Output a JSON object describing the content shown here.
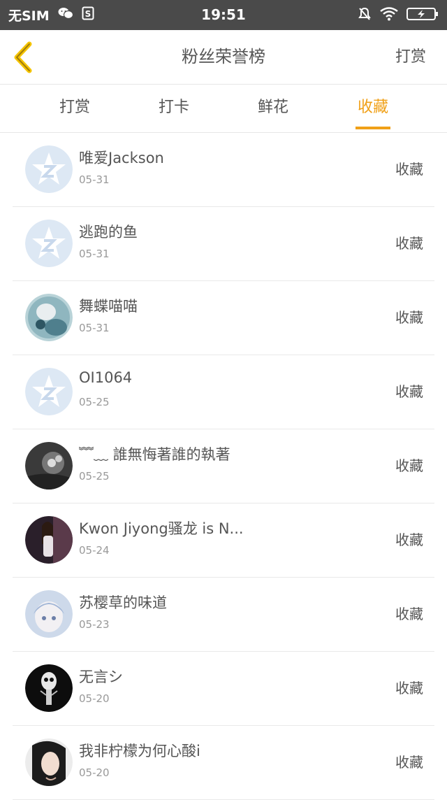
{
  "status_bar": {
    "carrier": "无SIM",
    "time": "19:51",
    "icons": [
      "wechat-icon",
      "sim-icon",
      "mute-icon",
      "wifi-icon",
      "battery-charging-icon"
    ]
  },
  "nav": {
    "title": "粉丝荣誉榜",
    "right_label": "打赏",
    "back_icon": "chevron-left-icon"
  },
  "tabs": [
    {
      "label": "打赏",
      "active": false
    },
    {
      "label": "打卡",
      "active": false
    },
    {
      "label": "鲜花",
      "active": false
    },
    {
      "label": "收藏",
      "active": true
    }
  ],
  "accent_color": "#f0a017",
  "fans": [
    {
      "name": "唯爱Jackson",
      "date": "05-31",
      "action": "收藏",
      "avatar": "default-star-avatar"
    },
    {
      "name": "逃跑的鱼",
      "date": "05-31",
      "action": "收藏",
      "avatar": "default-star-avatar"
    },
    {
      "name": "舞蝶喵喵",
      "date": "05-31",
      "action": "收藏",
      "avatar": "anime-girl-avatar"
    },
    {
      "name": "OI1064",
      "date": "05-25",
      "action": "收藏",
      "avatar": "default-star-avatar"
    },
    {
      "name": "﹌﹏ 誰無悔著誰的執著",
      "date": "05-25",
      "action": "收藏",
      "avatar": "dark-photo-avatar"
    },
    {
      "name": "Kwon Jiyong骚龙 is N...",
      "date": "05-24",
      "action": "收藏",
      "avatar": "person-photo-avatar"
    },
    {
      "name": "苏樱草的味道",
      "date": "05-23",
      "action": "收藏",
      "avatar": "anime-girl-avatar"
    },
    {
      "name": "无言シ",
      "date": "05-20",
      "action": "收藏",
      "avatar": "skull-avatar"
    },
    {
      "name": "我非柠檬为何心酸i",
      "date": "05-20",
      "action": "收藏",
      "avatar": "portrait-avatar"
    }
  ]
}
